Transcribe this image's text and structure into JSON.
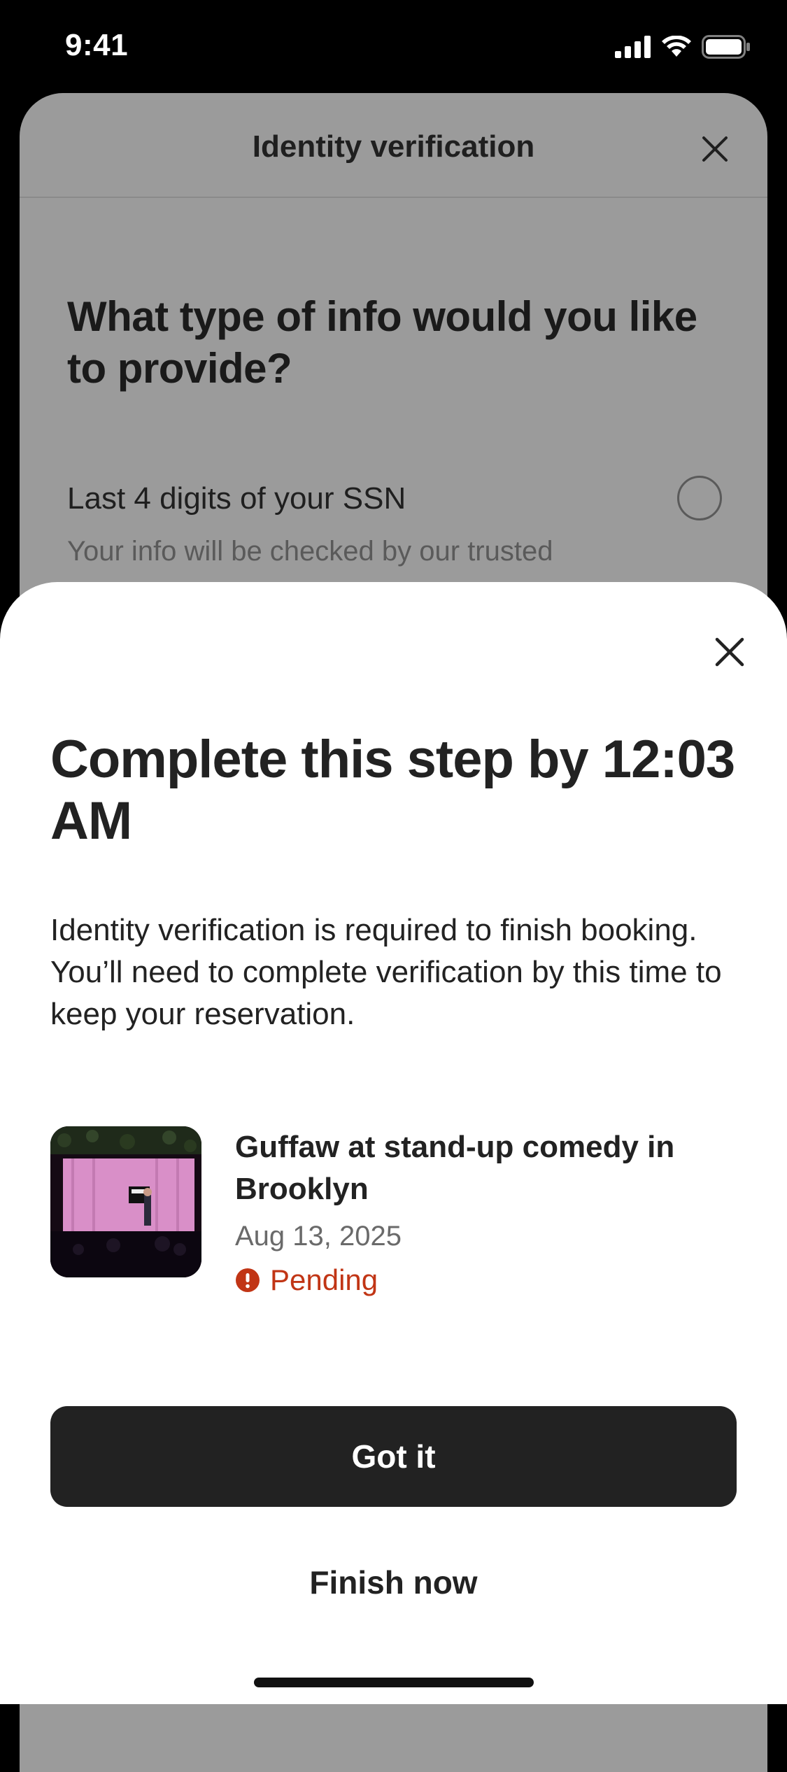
{
  "status_bar": {
    "time": "9:41",
    "icons": [
      "cellular-signal-icon",
      "wifi-icon",
      "battery-icon"
    ]
  },
  "background_sheet": {
    "title": "Identity verification",
    "close_icon": "close-icon",
    "question": "What type of info would you like to provide?",
    "option": {
      "label": "Last 4 digits of your SSN",
      "description": "Your info will be checked by our trusted verification partners."
    }
  },
  "sheet": {
    "close_icon": "close-icon",
    "title": "Complete this step by 12:03 AM",
    "body": "Identity verification is required to finish booking. You’ll need to complete verification by this time to keep your reservation.",
    "listing": {
      "title": "Guffaw at stand-up comedy in Brooklyn",
      "date": "Aug 13, 2025",
      "status": "Pending",
      "status_icon": "alert-icon"
    },
    "primary_button": "Got it",
    "secondary_button": "Finish now"
  },
  "colors": {
    "status_pending": "#c13515",
    "primary_button": "#222222",
    "overlay": "#9b9b9b"
  }
}
